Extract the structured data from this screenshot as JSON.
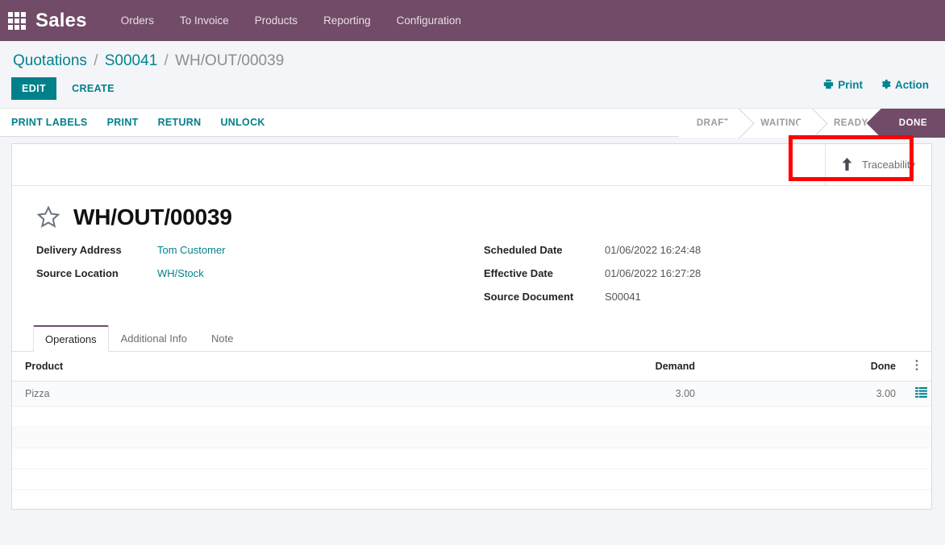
{
  "navbar": {
    "apps_icon": "grid-apps-icon",
    "brand": "Sales",
    "menu": [
      {
        "label": "Orders"
      },
      {
        "label": "To Invoice"
      },
      {
        "label": "Products"
      },
      {
        "label": "Reporting"
      },
      {
        "label": "Configuration"
      }
    ],
    "background": "#714B67"
  },
  "breadcrumb": {
    "root": "Quotations",
    "sep1": "/",
    "parent": "S00041",
    "sep2": "/",
    "current": "WH/OUT/00039"
  },
  "control_panel": {
    "edit_label": "EDIT",
    "create_label": "CREATE",
    "print_label": "Print",
    "print_icon": "printer-icon",
    "action_label": "Action",
    "action_icon": "gear-icon"
  },
  "statusbar": {
    "buttons": [
      {
        "label": "PRINT LABELS"
      },
      {
        "label": "PRINT"
      },
      {
        "label": "RETURN"
      },
      {
        "label": "UNLOCK"
      }
    ],
    "stages": [
      {
        "label": "DRAFT",
        "active": false
      },
      {
        "label": "WAITING",
        "active": false
      },
      {
        "label": "READY",
        "active": false
      },
      {
        "label": "DONE",
        "active": true
      }
    ],
    "active_color": "#714B67"
  },
  "sheet": {
    "stat_button": {
      "label": "Traceability",
      "icon": "arrow-up-icon",
      "highlight_color": "#ff0000"
    },
    "star_icon": "star-outline-icon",
    "title": "WH/OUT/00039",
    "fields_left": [
      {
        "label": "Delivery Address",
        "value": "Tom Customer",
        "is_link": true
      },
      {
        "label": "Source Location",
        "value": "WH/Stock",
        "is_link": true
      }
    ],
    "fields_right": [
      {
        "label": "Scheduled Date",
        "value": "01/06/2022 16:24:48",
        "is_link": false
      },
      {
        "label": "Effective Date",
        "value": "01/06/2022 16:27:28",
        "is_link": false
      },
      {
        "label": "Source Document",
        "value": "S00041",
        "is_link": false
      }
    ],
    "tabs": [
      {
        "label": "Operations",
        "active": true
      },
      {
        "label": "Additional Info",
        "active": false
      },
      {
        "label": "Note",
        "active": false
      }
    ],
    "table": {
      "columns": [
        "Product",
        "Demand",
        "Done"
      ],
      "options_icon": "vertical-dots-icon",
      "rows": [
        {
          "product": "Pizza",
          "demand": "3.00",
          "done": "3.00",
          "detail_icon": "list-details-icon"
        }
      ]
    }
  }
}
